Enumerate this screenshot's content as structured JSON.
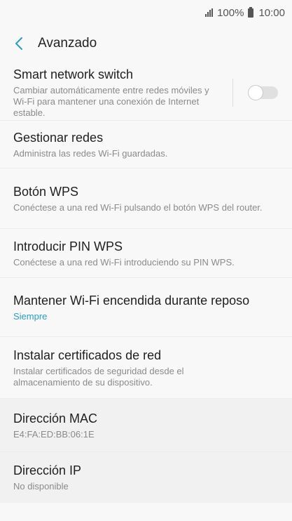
{
  "status_bar": {
    "battery": "100%",
    "time": "10:00"
  },
  "app_bar": {
    "title": "Avanzado"
  },
  "settings": [
    {
      "title": "Smart network switch",
      "subtitle": "Cambiar automáticamente entre redes móviles y Wi-Fi para mantener una conexión de Internet estable.",
      "toggle": false
    },
    {
      "title": "Gestionar redes",
      "subtitle": "Administra las redes Wi-Fi guardadas."
    },
    {
      "title": "Botón WPS",
      "subtitle": "Conéctese a una red Wi-Fi pulsando el botón WPS del router."
    },
    {
      "title": "Introducir PIN WPS",
      "subtitle": "Conéctese a una red Wi-Fi introduciendo su PIN WPS."
    },
    {
      "title": "Mantener Wi-Fi encendida durante reposo",
      "subtitle": "Siempre"
    },
    {
      "title": "Instalar certificados de red",
      "subtitle": "Instalar certificados de seguridad desde el almacenamiento de su dispositivo."
    },
    {
      "title": "Dirección MAC",
      "subtitle": "E4:FA:ED:BB:06:1E"
    },
    {
      "title": "Dirección IP",
      "subtitle": "No disponible"
    }
  ],
  "colors": {
    "accent": "#2a9dc4",
    "background": "#f8f8f8"
  }
}
